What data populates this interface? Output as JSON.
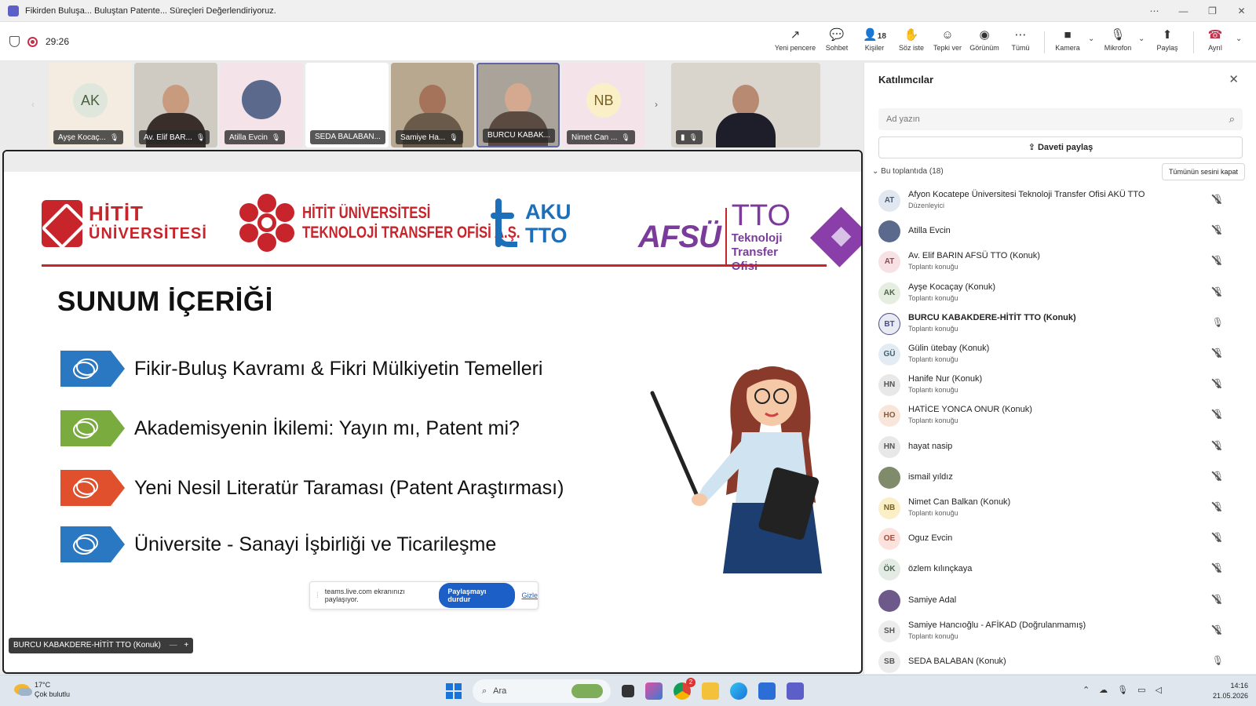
{
  "window": {
    "title": "Fikirden Buluşa... Buluştan Patente... Süreçleri Değerlendiriyoruz.",
    "controls": [
      "⋯",
      "—",
      "❐",
      "✕"
    ]
  },
  "meeting_bar": {
    "timer": "29:26",
    "buttons": [
      {
        "label": "Yeni pencere",
        "icon": "↗"
      },
      {
        "label": "Sohbet",
        "icon": "💬"
      },
      {
        "label": "Kişiler",
        "icon": "👤",
        "count": "18"
      },
      {
        "label": "Söz iste",
        "icon": "✋"
      },
      {
        "label": "Tepki ver",
        "icon": "☺"
      },
      {
        "label": "Görünüm",
        "icon": "◉"
      },
      {
        "label": "Tümü",
        "icon": "⋯"
      },
      {
        "label": "Kamera",
        "icon": "■"
      },
      {
        "label": "Mikrofon",
        "icon": "🎙"
      },
      {
        "label": "Paylaş",
        "icon": "⬆"
      },
      {
        "label": "Ayrıl",
        "icon": "☎"
      }
    ]
  },
  "gallery": {
    "tiles": [
      {
        "name": "Ayşe Kocaç...",
        "initials": "AK"
      },
      {
        "name": "Av. Elif BAR..."
      },
      {
        "name": "Atilla Evcin"
      },
      {
        "name": "SEDA BALABAN..."
      },
      {
        "name": "Samiye Ha..."
      },
      {
        "name": "BURCU KABAK..."
      },
      {
        "name": "Nimet Can ...",
        "initials": "NB"
      }
    ]
  },
  "slide": {
    "logos": {
      "hitit_line1": "HİTİT",
      "hitit_line2": "ÜNİVERSİTESİ",
      "hts_line1": "HİTİT ÜNİVERSİTESİ",
      "hts_line2": "TEKNOLOJİ TRANSFER OFİSİ A.Ş.",
      "aku_line1": "AKU",
      "aku_line2": "TTO",
      "afsu": "AFSÜ",
      "afsu_tto": "TTO",
      "afsu_sub1": "Teknoloji",
      "afsu_sub2": "Transfer Ofisi"
    },
    "heading": "SUNUM İÇERİĞİ",
    "items": [
      {
        "text": "Fikir-Buluş Kavramı & Fikri Mülkiyetin Temelleri",
        "color": "#2a78c2"
      },
      {
        "text": "Akademisyenin İkilemi: Yayın mı, Patent mi?",
        "color": "#7aab3e"
      },
      {
        "text": "Yeni Nesil Literatür Taraması (Patent Araştırması)",
        "color": "#e1502d"
      },
      {
        "text": "Üniversite - Sanayi İşbirliği ve Ticarileşme",
        "color": "#2a78c2"
      }
    ]
  },
  "share_bar": {
    "text": "teams.live.com ekranınızı paylaşıyor.",
    "stop": "Paylaşmayı durdur",
    "hide": "Gizle"
  },
  "presenter": {
    "name": "BURCU KABAKDERE-HİTİT TTO (Konuk)"
  },
  "participants_panel": {
    "title": "Katılımcılar",
    "search_placeholder": "Ad yazın",
    "invite_label": "Daveti paylaş",
    "section_label": "Bu toplantıda (18)",
    "mute_all": "Tümünün sesini kapat",
    "people": [
      {
        "initials": "AT",
        "name": "Afyon Kocatepe Üniversitesi Teknoloji Transfer Ofisi AKÜ TTO",
        "role": "Düzenleyici",
        "muted": true,
        "bg": "#e1e7f0",
        "fg": "#4a5a70"
      },
      {
        "initials": "",
        "name": "Atilla Evcin",
        "role": "",
        "muted": true,
        "bg": "#5b6a8c",
        "fg": "#fff"
      },
      {
        "initials": "AT",
        "name": "Av. Elif BARIN AFSÜ TTO (Konuk)",
        "role": "Toplantı konuğu",
        "muted": true,
        "bg": "#f7e1e4",
        "fg": "#8a4b55"
      },
      {
        "initials": "AK",
        "name": "Ayşe Kocaçay (Konuk)",
        "role": "Toplantı konuğu",
        "muted": true,
        "bg": "#e6eee2",
        "fg": "#4f6744"
      },
      {
        "initials": "BT",
        "name": "BURCU KABAKDERE-HİTİT TTO (Konuk)",
        "role": "Toplantı konuğu",
        "muted": false,
        "bg": "#e8eaf4",
        "fg": "#4a4f80",
        "bold": true
      },
      {
        "initials": "GÜ",
        "name": "Gülin ütebay (Konuk)",
        "role": "Toplantı konuğu",
        "muted": true,
        "bg": "#e3ecf2",
        "fg": "#45606f"
      },
      {
        "initials": "HN",
        "name": "Hanife Nur (Konuk)",
        "role": "Toplantı konuğu",
        "muted": true,
        "bg": "#e8e8e8",
        "fg": "#555"
      },
      {
        "initials": "HO",
        "name": "HATİCE YONCA ONUR (Konuk)",
        "role": "Toplantı konuğu",
        "muted": true,
        "bg": "#f9e6da",
        "fg": "#8a5a3c"
      },
      {
        "initials": "HN",
        "name": "hayat nasip",
        "role": "",
        "muted": true,
        "bg": "#e8e8e8",
        "fg": "#555"
      },
      {
        "initials": "",
        "name": "ismail yıldız",
        "role": "",
        "muted": true,
        "bg": "#7f8b6a",
        "fg": "#fff"
      },
      {
        "initials": "NB",
        "name": "Nimet Can Balkan (Konuk)",
        "role": "Toplantı konuğu",
        "muted": true,
        "bg": "#fbefc8",
        "fg": "#7a6220"
      },
      {
        "initials": "OE",
        "name": "Oguz Evcin",
        "role": "",
        "muted": true,
        "bg": "#fbe2dc",
        "fg": "#a34a3a"
      },
      {
        "initials": "ÖK",
        "name": "özlem kılınçkaya",
        "role": "",
        "muted": true,
        "bg": "#e3ebe4",
        "fg": "#4b6650"
      },
      {
        "initials": "",
        "name": "Samiye Adal",
        "role": "",
        "muted": true,
        "bg": "#6d5a8a",
        "fg": "#fff"
      },
      {
        "initials": "SH",
        "name": "Samiye Hancıoğlu - AFİKAD (Doğrulanmamış)",
        "role": "Toplantı konuğu",
        "muted": true,
        "bg": "#ececec",
        "fg": "#555"
      },
      {
        "initials": "SB",
        "name": "SEDA BALABAN (Konuk)",
        "role": "",
        "muted": false,
        "bg": "#ececec",
        "fg": "#555"
      }
    ]
  },
  "taskbar": {
    "temperature": "17°C",
    "weather": "Çok bulutlu",
    "search": "Ara",
    "time": "14:16",
    "date": "21.05.2026",
    "notification_badge": "2"
  }
}
